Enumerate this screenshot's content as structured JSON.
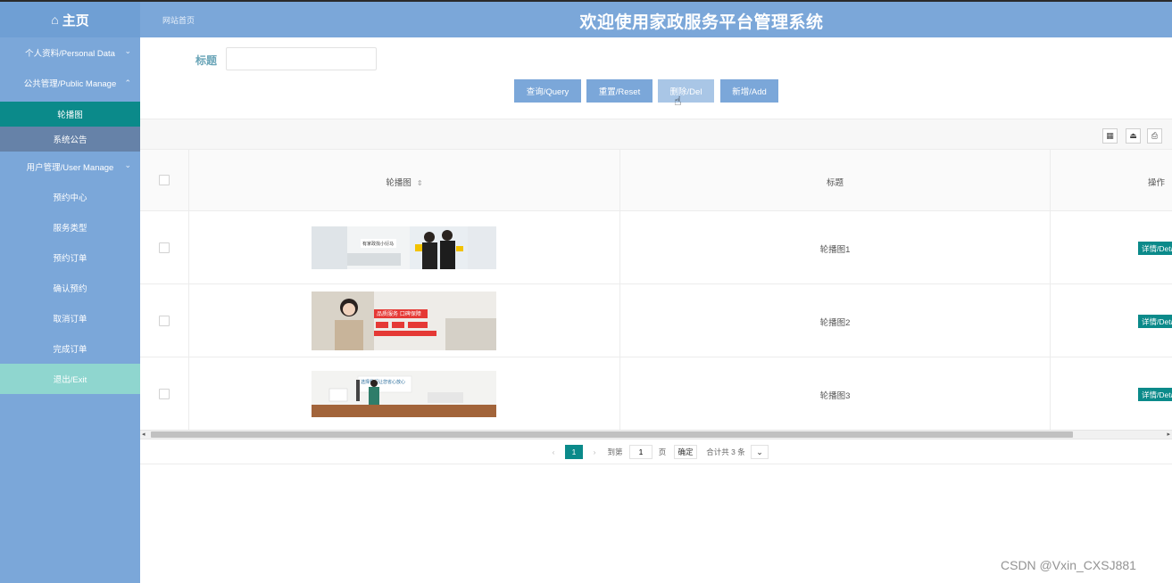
{
  "header": {
    "home_icon": "house-icon",
    "home_label": "主页",
    "breadcrumb": "网站首页",
    "title": "欢迎使用家政服务平台管理系统"
  },
  "sidebar": {
    "items": [
      {
        "label": "个人资料/Personal Data",
        "chevron": "chevron-down-icon"
      },
      {
        "label": "公共管理/Public Manage",
        "chevron": "chevron-up-icon"
      }
    ],
    "public_sub": [
      {
        "label": "轮播图"
      },
      {
        "label": "系统公告"
      }
    ],
    "user_manage": {
      "label": "用户管理/User Manage",
      "chevron": "chevron-down-icon"
    },
    "user_sub": [
      {
        "label": "预约中心"
      },
      {
        "label": "服务类型"
      },
      {
        "label": "预约订单"
      },
      {
        "label": "确认预约"
      },
      {
        "label": "取消订单"
      },
      {
        "label": "完成订单"
      }
    ],
    "exit": "退出/Exit"
  },
  "search": {
    "label": "标题",
    "value": "",
    "placeholder": ""
  },
  "actions": {
    "query": "查询/Query",
    "reset": "重置/Reset",
    "delete": "删除/Del",
    "add": "新增/Add"
  },
  "toolbar": {
    "icons": [
      "columns-icon",
      "export-icon",
      "print-icon"
    ]
  },
  "table": {
    "headers": {
      "image": "轮播图",
      "title": "标题",
      "op": "操作"
    },
    "rows": [
      {
        "title": "轮播图1",
        "detail": "详情/Detail",
        "banner_text": "有家政找小衍马"
      },
      {
        "title": "轮播图2",
        "detail": "详情/Detail",
        "banner_text": "品质服务 口碑保障"
      },
      {
        "title": "轮播图3",
        "detail": "详情/Detail",
        "banner_text": "选择我们让您省心放心"
      }
    ]
  },
  "pagination": {
    "prev": "‹",
    "current": "1",
    "next": "›",
    "goto_label": "到第",
    "goto_value": "1",
    "page_unit": "页",
    "confirm": "确定",
    "total": "合计共 3 条",
    "size_caret": "⌄"
  },
  "watermark": "CSDN @Vxin_CXSJ881",
  "colors": {
    "primary": "#7ba7d9",
    "teal": "#0b8a8a",
    "exit": "#8fd6cf"
  }
}
